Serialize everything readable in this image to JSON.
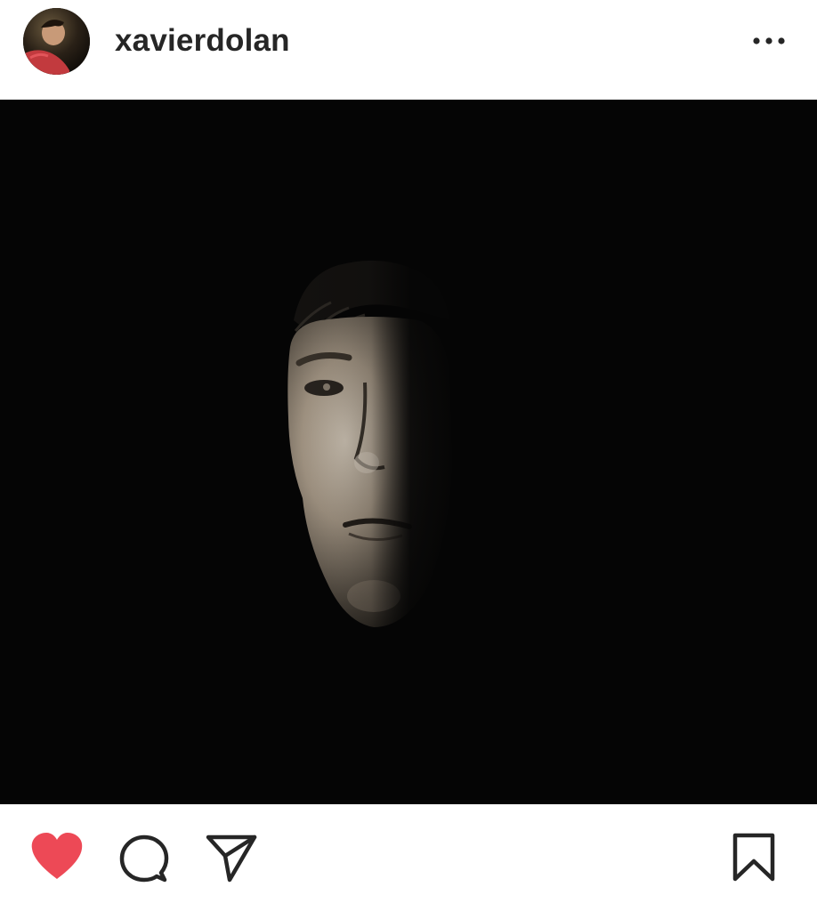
{
  "header": {
    "username": "xavierdolan",
    "avatar_icon": "profile-avatar",
    "more_icon": "more-horizontal-icon"
  },
  "post": {
    "image_icon": "portrait-photo",
    "liked": true,
    "colors": {
      "like_active": "#ed4956",
      "icon_stroke": "#262626",
      "photo_background": "#050505"
    }
  },
  "actions": {
    "like_icon": "heart-icon",
    "comment_icon": "comment-icon",
    "share_icon": "paper-plane-icon",
    "save_icon": "bookmark-icon"
  }
}
